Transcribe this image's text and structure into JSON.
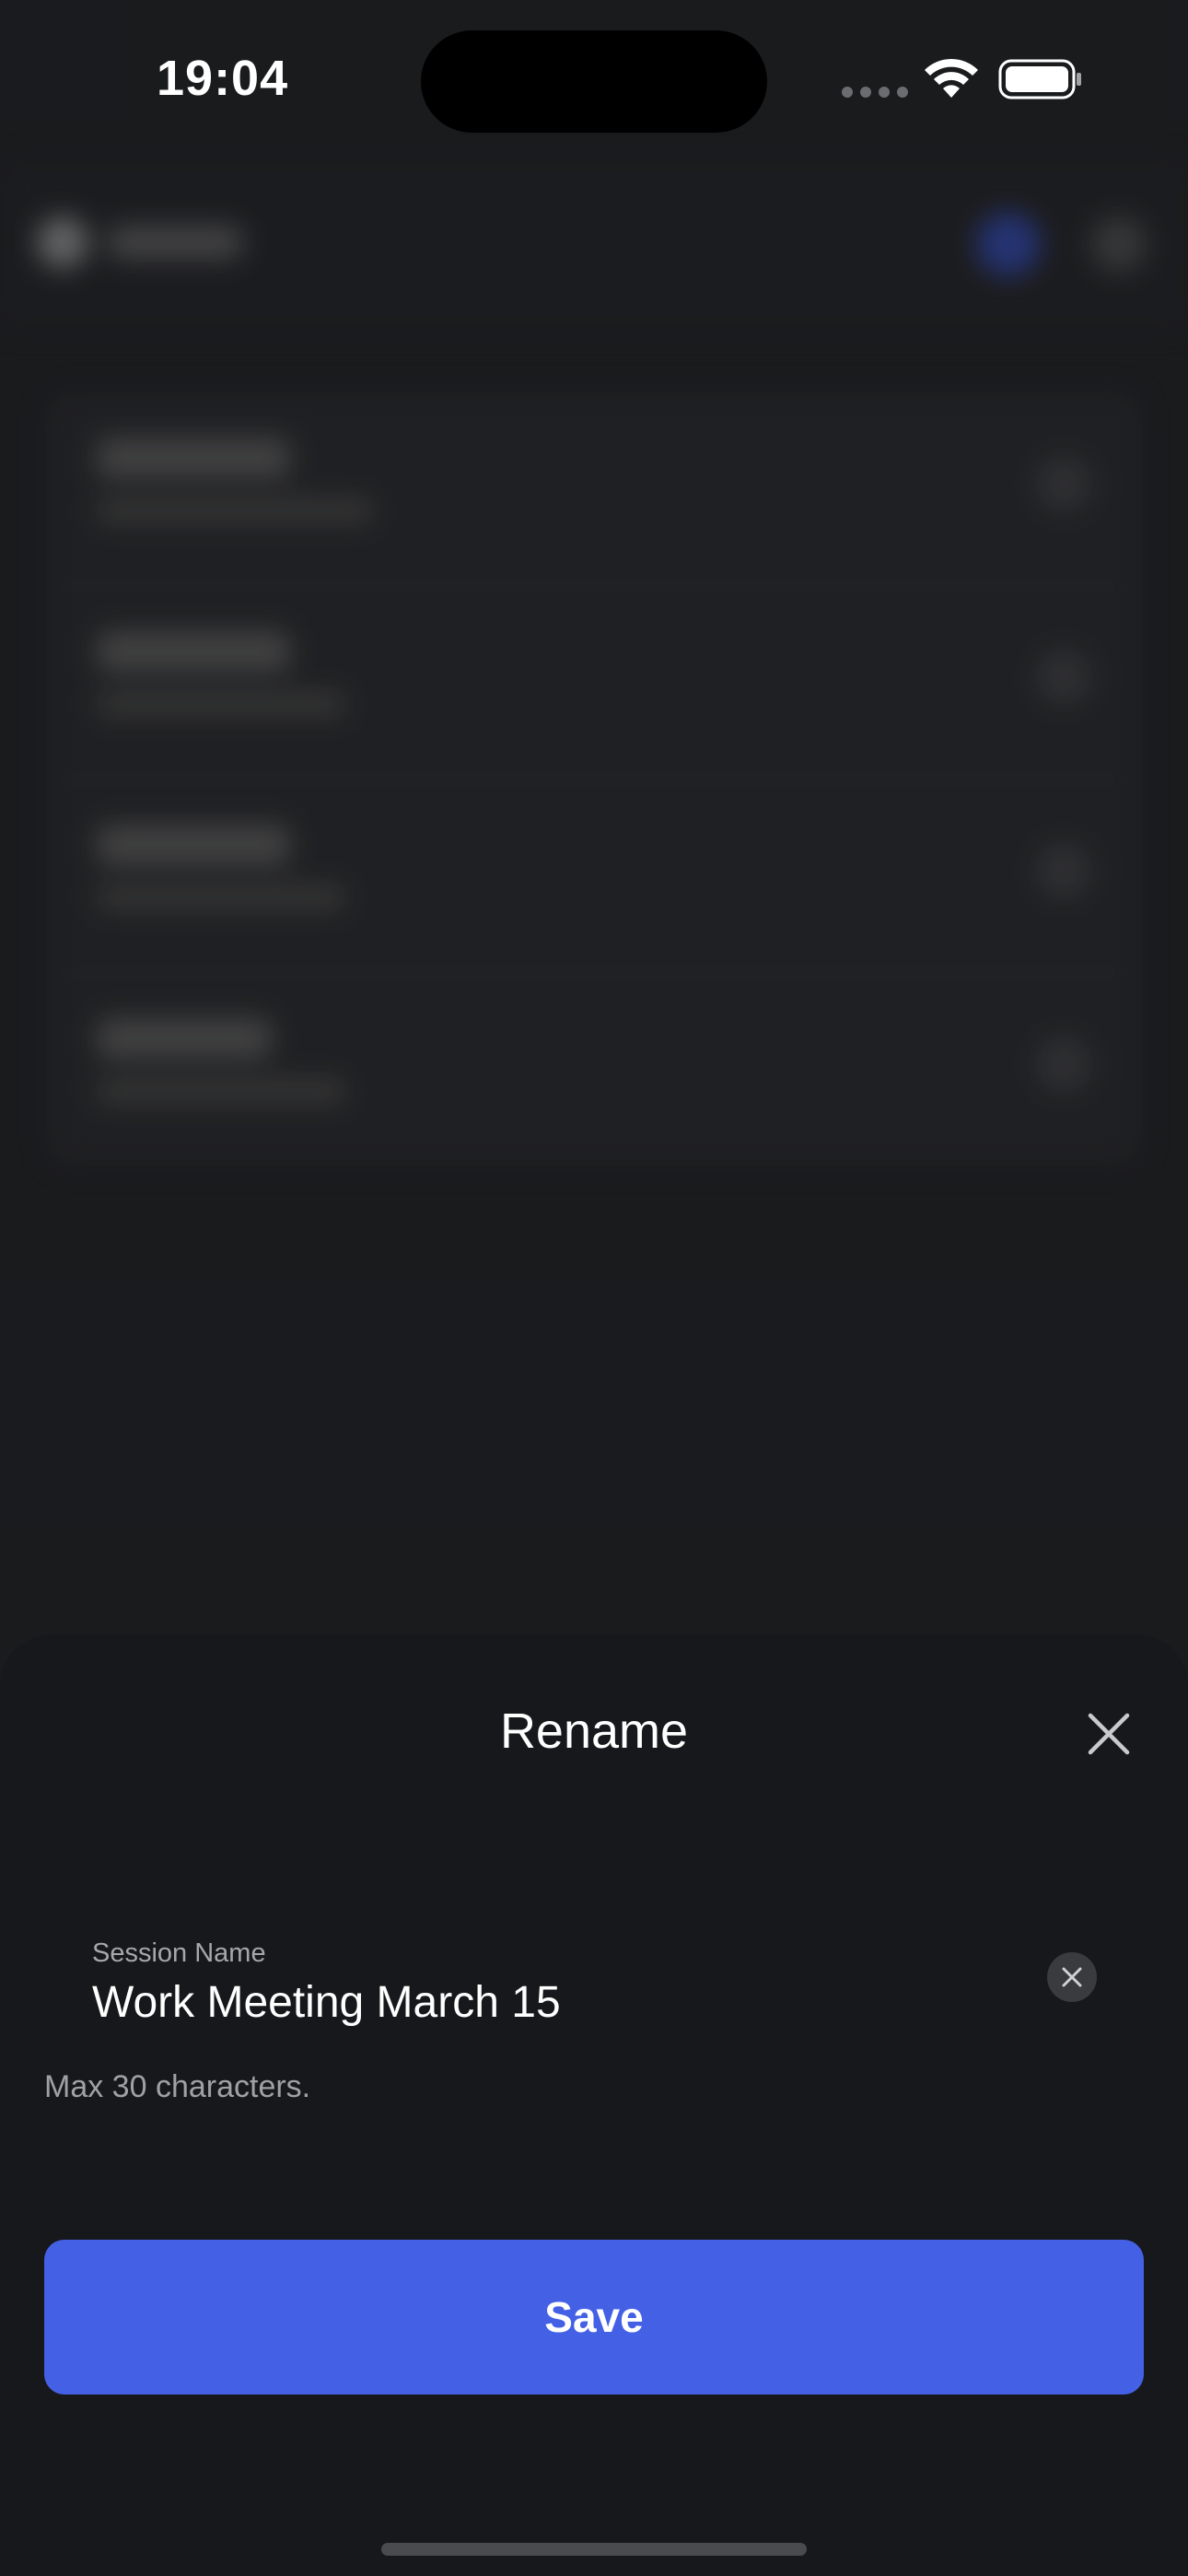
{
  "status_bar": {
    "time": "19:04"
  },
  "sheet": {
    "title": "Rename",
    "field": {
      "label": "Session Name",
      "value": "Work Meeting March 15"
    },
    "helper_text": "Max 30 characters.",
    "save_label": "Save"
  },
  "colors": {
    "accent": "#4461e6",
    "sheet_background": "#17181b",
    "background": "#202124"
  },
  "icons": {
    "close": "close-icon",
    "clear": "clear-icon",
    "wifi": "wifi-icon",
    "battery": "battery-icon"
  }
}
